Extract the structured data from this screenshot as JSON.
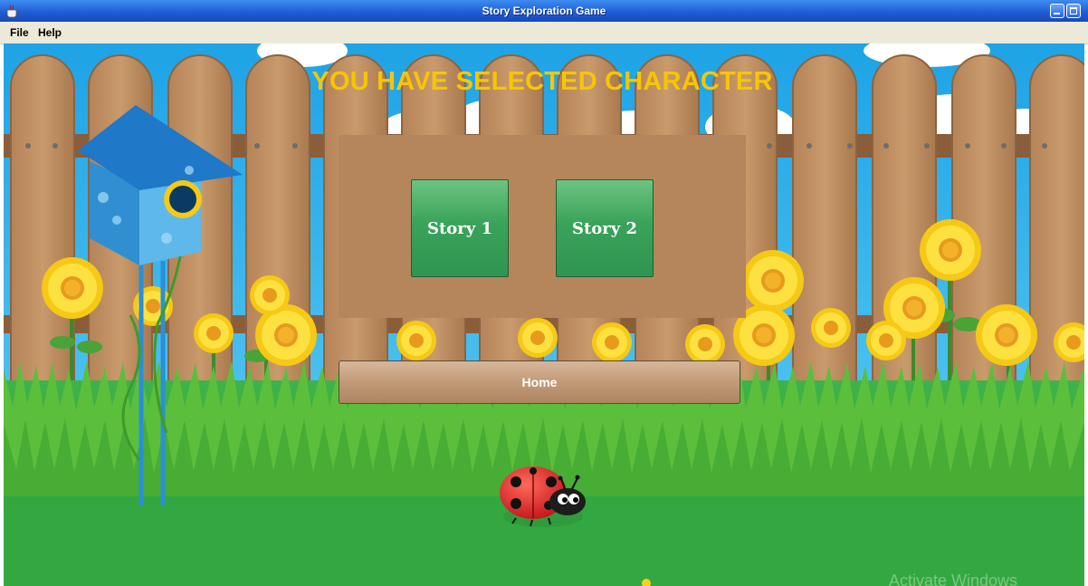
{
  "window": {
    "title": "Story Exploration Game"
  },
  "menu": {
    "file": "File",
    "help": "Help"
  },
  "screen": {
    "heading": "YOU HAVE SELECTED CHARACTER",
    "story_buttons": [
      "Story 1",
      "Story 2"
    ],
    "home_label": "Home"
  },
  "watermark": "Activate Windows",
  "colors": {
    "heading": "#f7c600",
    "panel": "#b5865c",
    "story_button": "#3aa35a",
    "titlebar": "#1f5fd6"
  }
}
